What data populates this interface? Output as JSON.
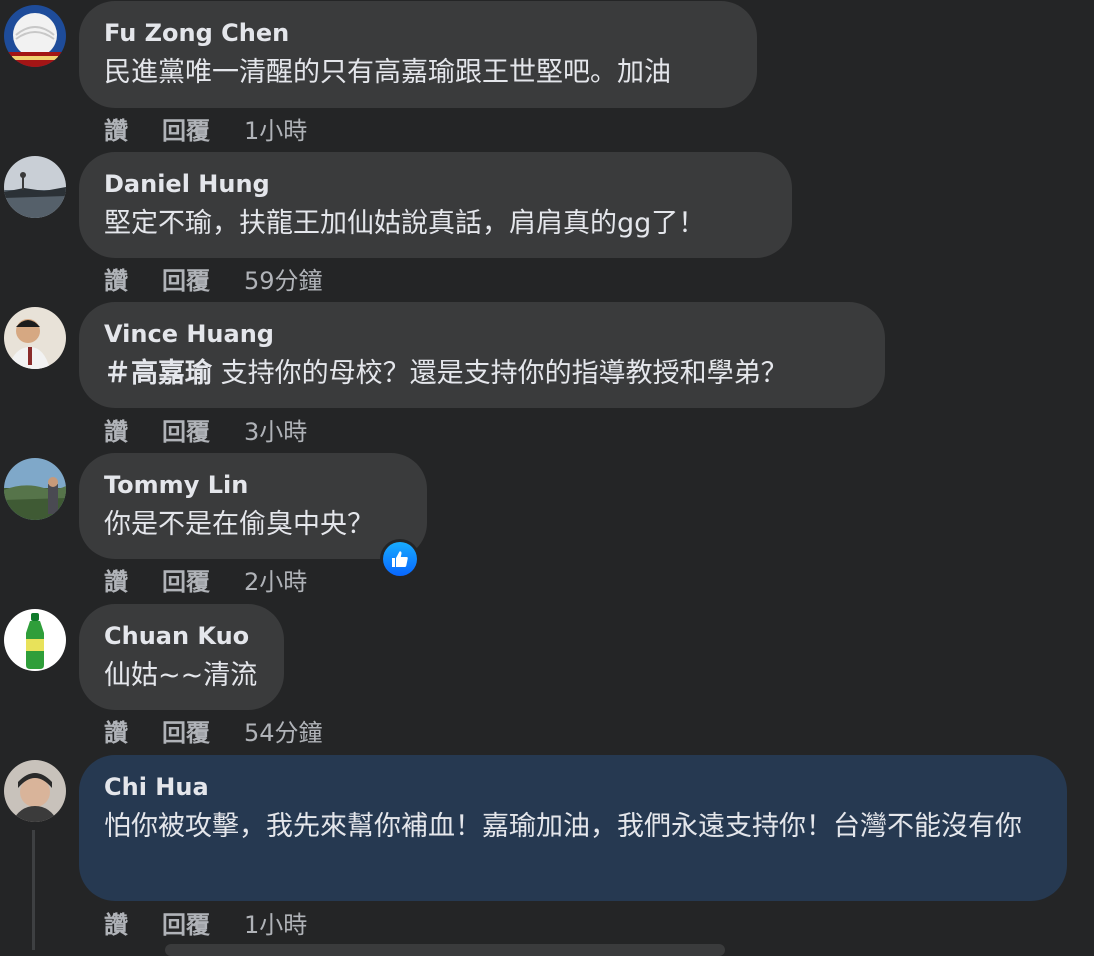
{
  "actions": {
    "like": "讚",
    "reply": "回覆"
  },
  "comments": [
    {
      "author": "Fu Zong Chen",
      "text": "民進黨唯一清醒的只有高嘉瑜跟王世堅吧。加油",
      "time": "1小時"
    },
    {
      "author": "Daniel Hung",
      "text": "堅定不瑜，扶龍王加仙姑說真話，肩肩真的gg了！",
      "time": "59分鐘"
    },
    {
      "author": "Vince Huang",
      "hashtag": "＃高嘉瑜",
      "text": " 支持你的母校？還是支持你的指導教授和學弟？",
      "time": "3小時"
    },
    {
      "author": "Tommy Lin",
      "text": "你是不是在偷臭中央？",
      "time": "2小時",
      "reaction": "like-icon"
    },
    {
      "author": "Chuan Kuo",
      "text": "仙姑~~清流",
      "time": "54分鐘"
    },
    {
      "author": "Chi Hua",
      "text": "怕你被攻擊，我先來幫你補血！嘉瑜加油，我們永遠支持你！台灣不能沒有你",
      "time": "1小時"
    }
  ],
  "colors": {
    "background": "#242526",
    "bubble": "#3a3b3c",
    "highlight_bubble": "#263951",
    "like_blue": "#0866ff"
  }
}
